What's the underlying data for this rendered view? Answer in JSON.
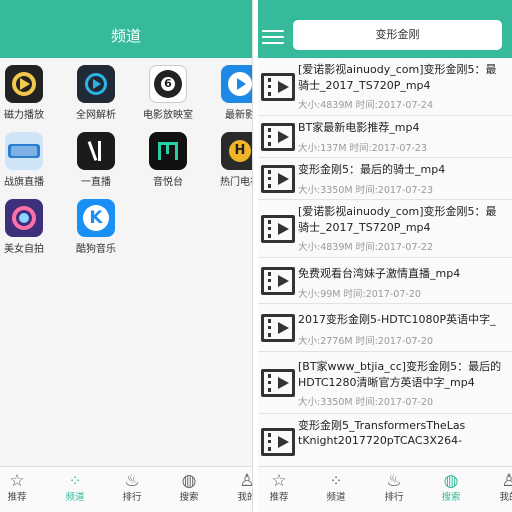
{
  "left_screen": {
    "header": {
      "title": "频道"
    },
    "apps": [
      {
        "label": "磁力播放",
        "icon": "magnet-player-icon"
      },
      {
        "label": "全网解析",
        "icon": "web-parse-icon"
      },
      {
        "label": "电影放映室",
        "icon": "film-reel-icon"
      },
      {
        "label": "最新影",
        "icon": "latest-video-icon"
      },
      {
        "label": "战旗直播",
        "icon": "zhanqi-tv-icon"
      },
      {
        "label": "一直播",
        "icon": "yizhibo-icon"
      },
      {
        "label": "音悦台",
        "icon": "yinyuetai-icon"
      },
      {
        "label": "热门电视",
        "icon": "hot-tv-icon"
      },
      {
        "label": "美女自拍",
        "icon": "selfie-icon"
      },
      {
        "label": "酷狗音乐",
        "icon": "kugou-music-icon"
      }
    ],
    "tabs": [
      {
        "label": "推荐",
        "icon": "star-icon"
      },
      {
        "label": "频道",
        "icon": "grid-dots-icon"
      },
      {
        "label": "排行",
        "icon": "flame-icon"
      },
      {
        "label": "搜索",
        "icon": "planet-icon"
      },
      {
        "label": "我的",
        "icon": "person-icon"
      }
    ]
  },
  "right_screen": {
    "search": {
      "value": "变形金刚"
    },
    "results": [
      {
        "title_lines": [
          "[爱诺影视ainuody_com]变形金刚5：最",
          "骑士_2017_TS720P_mp4"
        ],
        "meta": "大小:4839M 时间:2017-07-24"
      },
      {
        "title_lines": [
          "BT家最新电影推荐_mp4"
        ],
        "meta": "大小:137M 时间:2017-07-23"
      },
      {
        "title_lines": [
          "变形金刚5：最后的骑士_mp4"
        ],
        "meta": "大小:3350M 时间:2017-07-23"
      },
      {
        "title_lines": [
          "[爱诺影视ainuody_com]变形金刚5：最",
          "骑士_2017_TS720P_mp4"
        ],
        "meta": "大小:4839M 时间:2017-07-22"
      },
      {
        "title_lines": [
          "免费观看台湾妹子激情直播_mp4"
        ],
        "meta": "大小:99M 时间:2017-07-20"
      },
      {
        "title_lines": [
          "2017变形金刚5-HDTC1080P英语中字_"
        ],
        "meta": "大小:2776M 时间:2017-07-20"
      },
      {
        "title_lines": [
          "[BT家www_btjia_cc]变形金刚5：最后的",
          "HDTC1280清晰官方英语中字_mp4"
        ],
        "meta": "大小:3350M 时间:2017-07-20"
      },
      {
        "title_lines": [
          "变形金刚5_TransformersTheLas",
          "tKnight2017720pTCAC3X264-"
        ],
        "meta": ""
      }
    ],
    "tabs": [
      {
        "label": "推荐",
        "icon": "star-icon"
      },
      {
        "label": "频道",
        "icon": "grid-dots-icon"
      },
      {
        "label": "排行",
        "icon": "flame-icon"
      },
      {
        "label": "搜索",
        "icon": "planet-icon"
      },
      {
        "label": "我的",
        "icon": "person-icon"
      }
    ]
  },
  "colors": {
    "accent": "#35ba9b",
    "active_tab": "#35ba9b"
  }
}
